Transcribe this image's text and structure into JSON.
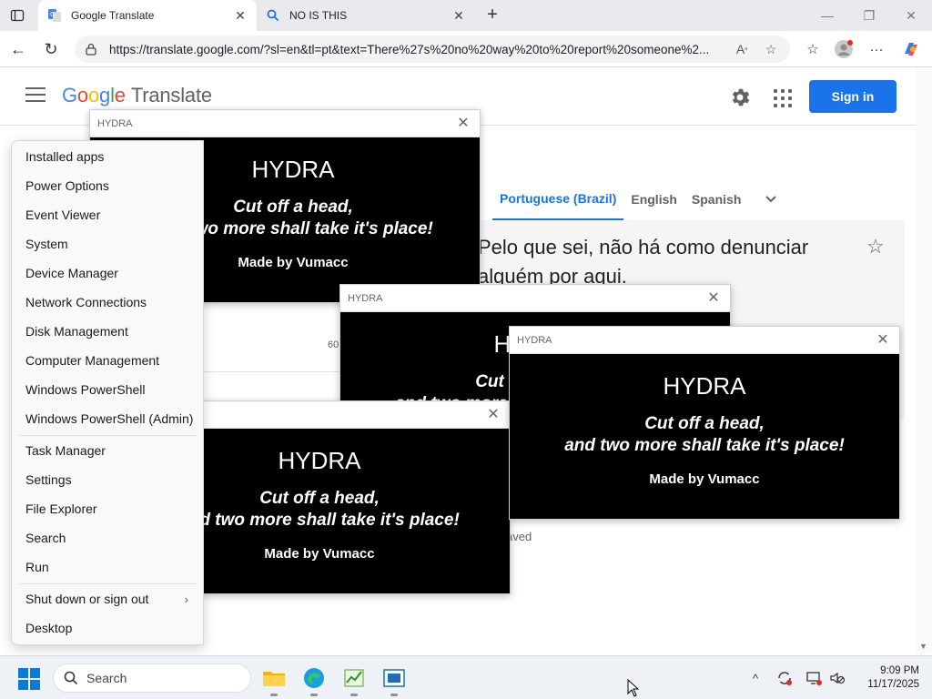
{
  "browser": {
    "tabs": [
      {
        "title": "Google Translate",
        "active": true
      },
      {
        "title": "NO IS THIS",
        "active": false
      }
    ],
    "url": "https://translate.google.com/?sl=en&tl=pt&text=There%27s%20no%20way%20to%20report%20someone%2..."
  },
  "translate": {
    "logo_google": [
      "G",
      "o",
      "o",
      "g",
      "l",
      "e"
    ],
    "logo_product": "Translate",
    "sign_in_label": "Sign in",
    "target_langs": [
      "Portuguese (Brazil)",
      "English",
      "Spanish"
    ],
    "selected_lang": "Portuguese (Brazil)",
    "result_text": "Pelo que sei, não há como denunciar alguém por aqui.",
    "char_count": "60",
    "saved_label": "aved"
  },
  "hydra": {
    "title": "HYDRA",
    "heading": "HYDRA",
    "line1": "Cut off a head,",
    "line2": "and two more shall take it's place!",
    "credit": "Made by Vumacc"
  },
  "winx_menu": {
    "items": [
      "Installed apps",
      "Power Options",
      "Event Viewer",
      "System",
      "Device Manager",
      "Network Connections",
      "Disk Management",
      "Computer Management",
      "Windows PowerShell",
      "Windows PowerShell (Admin)",
      "Task Manager",
      "Settings",
      "File Explorer",
      "Search",
      "Run",
      "Shut down or sign out",
      "Desktop"
    ]
  },
  "taskbar": {
    "search_placeholder": "Search",
    "time": "9:09 PM",
    "date": "11/17/2025"
  },
  "colors": {
    "google_blue": "#1a73e8",
    "hydra_bg": "#000000",
    "taskbar_bg": "#eef1f6"
  }
}
